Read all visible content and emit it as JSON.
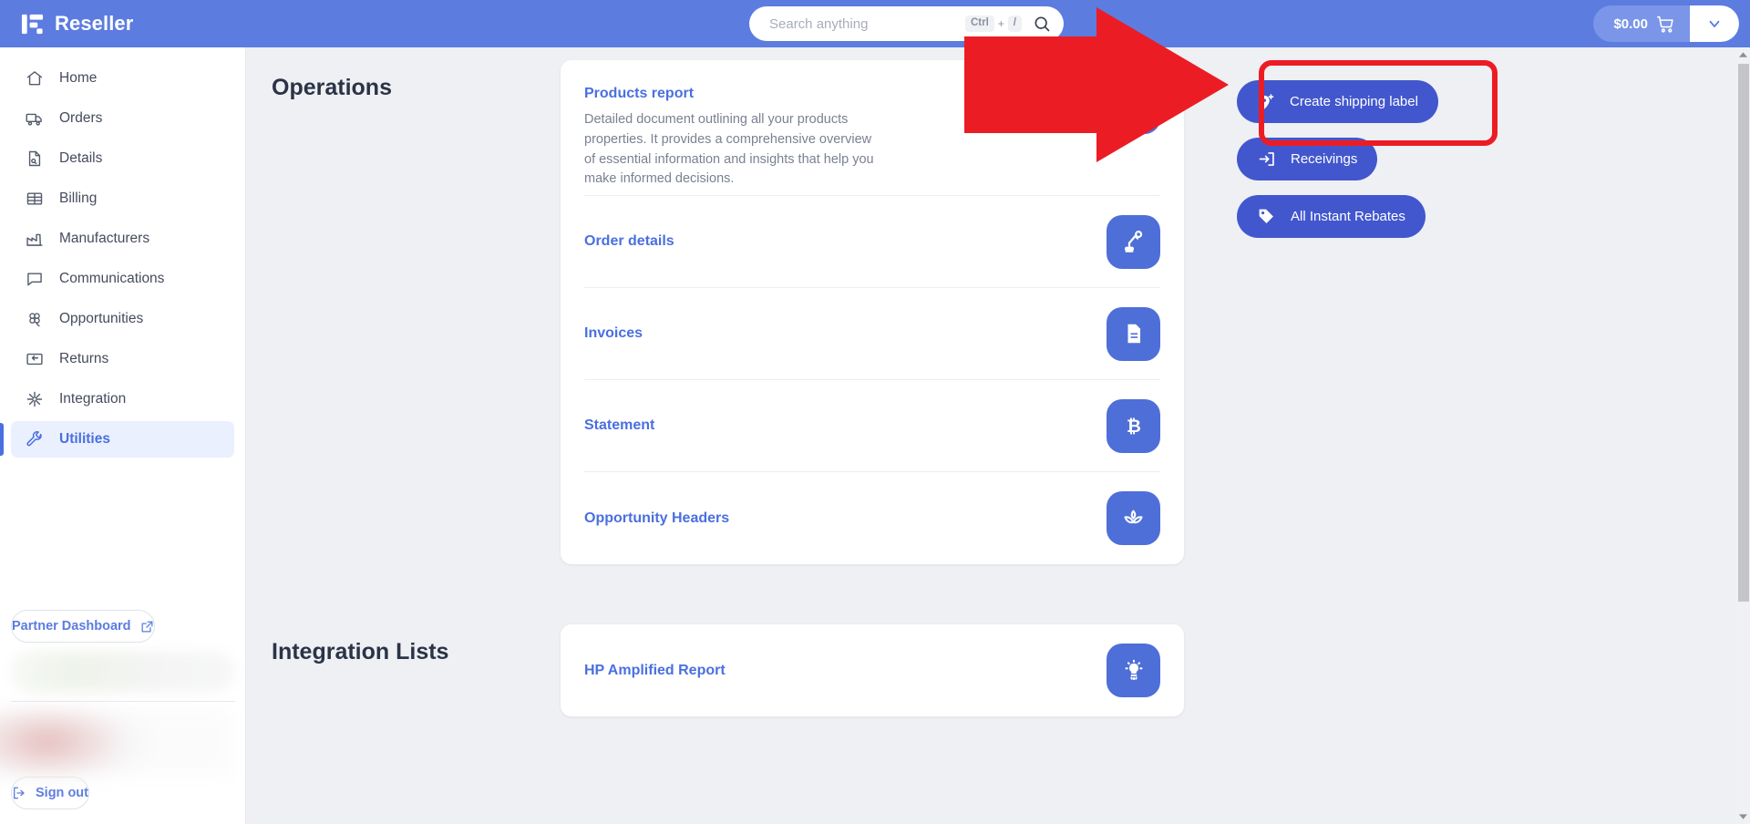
{
  "header": {
    "brand": "Reseller",
    "brand_logo_icon": "reseller-logo-icon",
    "search": {
      "placeholder": "Search anything",
      "value": "",
      "shortcut_key": "Ctrl",
      "shortcut_plus": "+",
      "shortcut_slash": "/",
      "search_icon": "search-icon"
    },
    "cart": {
      "amount": "$0.00",
      "cart_icon": "shopping-cart-icon",
      "caret_icon": "chevron-down-icon"
    },
    "bg_color": "#5c7ce0"
  },
  "sidebar": {
    "items": [
      {
        "label": "Home",
        "icon": "home-icon",
        "active": false
      },
      {
        "label": "Orders",
        "icon": "truck-icon",
        "active": false
      },
      {
        "label": "Details",
        "icon": "document-search-icon",
        "active": false
      },
      {
        "label": "Billing",
        "icon": "billing-list-icon",
        "active": false
      },
      {
        "label": "Manufacturers",
        "icon": "factory-icon",
        "active": false
      },
      {
        "label": "Communications",
        "icon": "chat-bubble-icon",
        "active": false
      },
      {
        "label": "Opportunities",
        "icon": "clover-icon",
        "active": false
      },
      {
        "label": "Returns",
        "icon": "return-arrow-icon",
        "active": false
      },
      {
        "label": "Integration",
        "icon": "integration-node-icon",
        "active": false
      },
      {
        "label": "Utilities",
        "icon": "wrench-icon",
        "active": true
      }
    ],
    "partner_dashboard": {
      "label": "Partner Dashboard",
      "icon": "external-link-icon"
    },
    "sign_out": {
      "label": "Sign out",
      "icon": "sign-out-icon"
    }
  },
  "main": {
    "sections": [
      {
        "title": "Operations",
        "rows": [
          {
            "title": "Products report",
            "desc": "Detailed document outlining all your products properties. It provides a comprehensive overview of essential information and insights that help you make informed decisions.",
            "icon": "products-report-icon"
          },
          {
            "title": "Order details",
            "desc": "",
            "icon": "robot-arm-icon"
          },
          {
            "title": "Invoices",
            "desc": "",
            "icon": "document-lines-icon"
          },
          {
            "title": "Statement",
            "desc": "",
            "icon": "bitcoin-icon"
          },
          {
            "title": "Opportunity Headers",
            "desc": "",
            "icon": "spa-leaf-icon"
          }
        ]
      },
      {
        "title": "Integration Lists",
        "rows": [
          {
            "title": "HP Amplified Report",
            "desc": "",
            "icon": "lightbulb-icon"
          }
        ]
      }
    ]
  },
  "actions": {
    "buttons": [
      {
        "label": "Create shipping label",
        "icon": "shipping-label-plus-icon",
        "highlighted": true
      },
      {
        "label": "Receivings",
        "icon": "inbox-arrow-icon",
        "highlighted": false
      },
      {
        "label": "All Instant Rebates",
        "icon": "tag-icon",
        "highlighted": false
      }
    ],
    "button_color": "#4257ce"
  },
  "annotations": {
    "highlight_color": "#ec1c24",
    "arrow_target": "Create shipping label",
    "arrow_icon": "right-arrow-annotation"
  },
  "scrollbar": {
    "up_icon": "scroll-up-arrow-icon",
    "down_icon": "scroll-down-arrow-icon"
  }
}
